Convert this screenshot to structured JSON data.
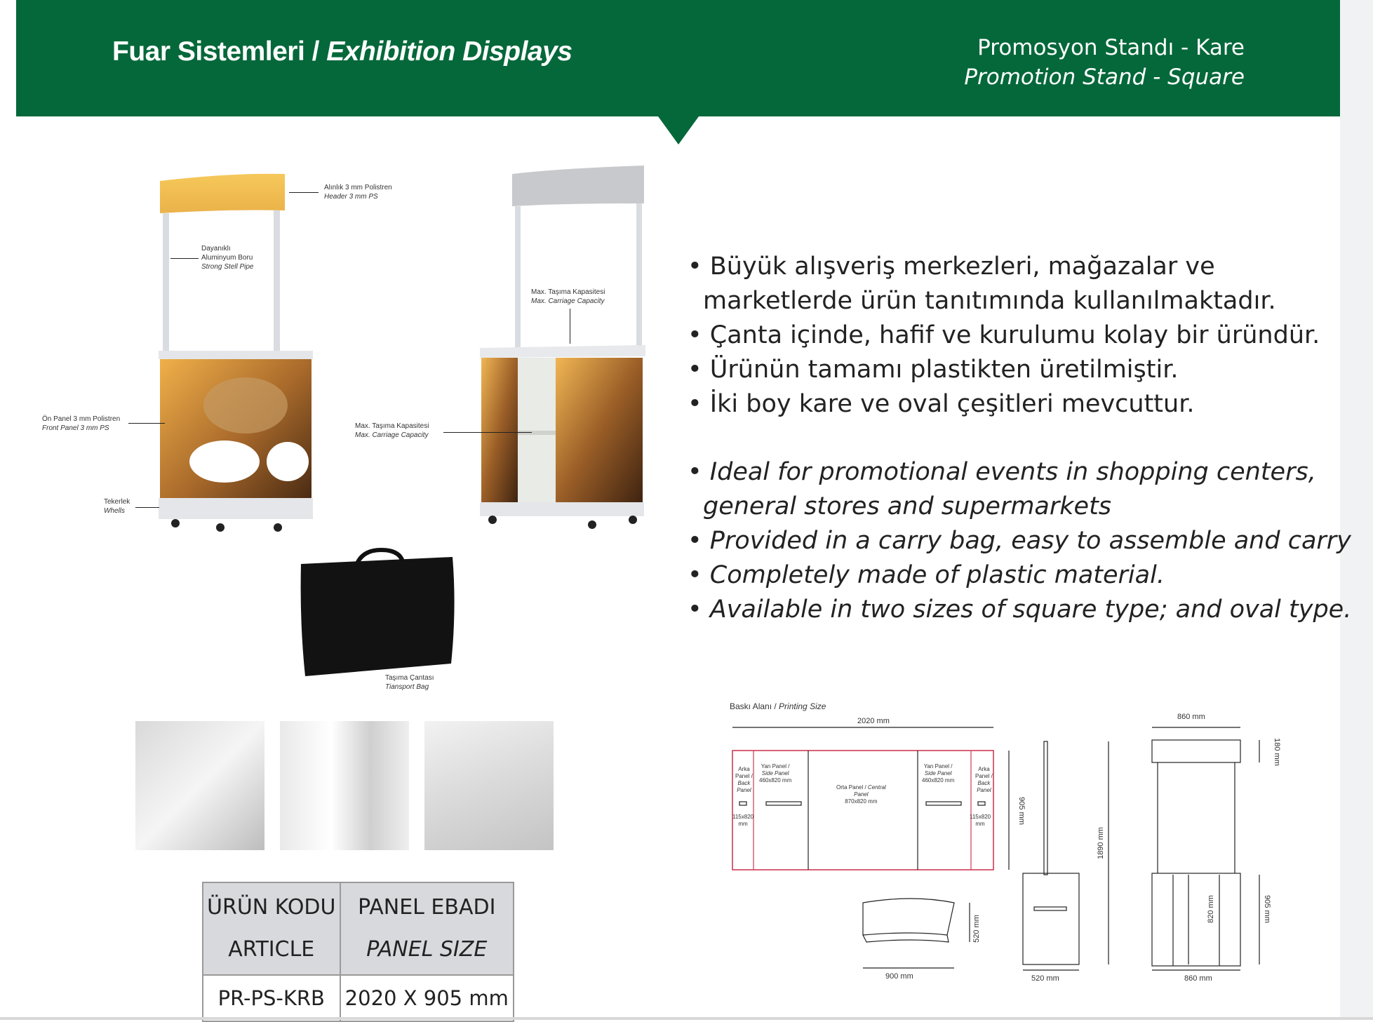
{
  "header": {
    "title_tr": "Fuar Sistemleri /",
    "title_en": "Exhibition Displays",
    "product_tr": "Promosyon Standı - Kare",
    "product_en": "Promotion Stand - Square",
    "color": "#05683a"
  },
  "features_tr": [
    "Büyük alışveriş merkezleri, mağazalar ve",
    "marketlerde ürün tanıtımında kullanılmaktadır.",
    "Çanta içinde, hafif ve kurulumu kolay bir üründür.",
    "Ürünün tamamı plastikten üretilmiştir.",
    "İki boy kare ve oval çeşitleri mevcuttur."
  ],
  "features_en": [
    "Ideal for promotional events in shopping  centers,",
    "general stores and supermarkets",
    "Provided in a carry bag, easy to assemble and carry",
    "Completely made of plastic material.",
    "Available in two sizes of square type; and oval type."
  ],
  "callouts": {
    "header_tr": "Alınlık 3 mm Polistren",
    "header_en": "Header 3 mm PS",
    "pipe_tr1": "Dayanıklı",
    "pipe_tr2": "Aluminyum Boru",
    "pipe_en": "Strong Stell Pipe",
    "front_tr": "Ön Panel 3 mm Polistren",
    "front_en": "Front Panel 3 mm PS",
    "wheels_tr": "Tekerlek",
    "wheels_en": "Whells",
    "capacity_tr": "Max. Taşıma Kapasitesi",
    "capacity_en": "Max. Carriage Capacity",
    "capacity2_tr": "Max. Taşıma Kapasitesi",
    "capacity2_en": "Max. Carriage Capacity",
    "bag_tr": "Taşıma Çantası",
    "bag_en": "Tiansport Bag"
  },
  "spec_table": {
    "col1_tr": "ÜRÜN KODU",
    "col1_en": "ARTICLE",
    "col2_tr": "PANEL EBADI",
    "col2_en": "PANEL SIZE",
    "code": "PR-PS-KRB",
    "size": "2020 X 905 mm"
  },
  "drawing": {
    "print_tr": "Baskı Alanı /",
    "print_en": "Printing Size",
    "width_total": "2020 mm",
    "height_panel": "905 mm",
    "back1_a": "Arka",
    "back1_b": "Panel /",
    "back1_c": "Back",
    "back1_d": "Panel",
    "back_size_a": "115x820",
    "back_size_b": "mm",
    "side1_a": "Yan Panel /",
    "side1_b": "Side Panel",
    "side1_c": "460x820 mm",
    "central_a": "Orta Panel /",
    "central_b": "Central",
    "central_c": "Panel",
    "central_d": "870x820 mm",
    "side2_a": "Yan Panel /",
    "side2_b": "Side Panel",
    "side2_c": "460x820 mm",
    "back2_a": "Arka",
    "back2_b": "Panel /",
    "back2_c": "Back",
    "back2_d": "Panel",
    "back2_size_a": "115x820",
    "back2_size_b": "mm",
    "top_width": "900 mm",
    "top_depth": "520 mm",
    "side_height": "1890 mm",
    "side_depth": "520 mm",
    "front_width_top": "860 mm",
    "front_header": "180 mm",
    "front_inner": "820 mm",
    "front_body": "905 mm",
    "front_width_bottom": "860 mm"
  }
}
